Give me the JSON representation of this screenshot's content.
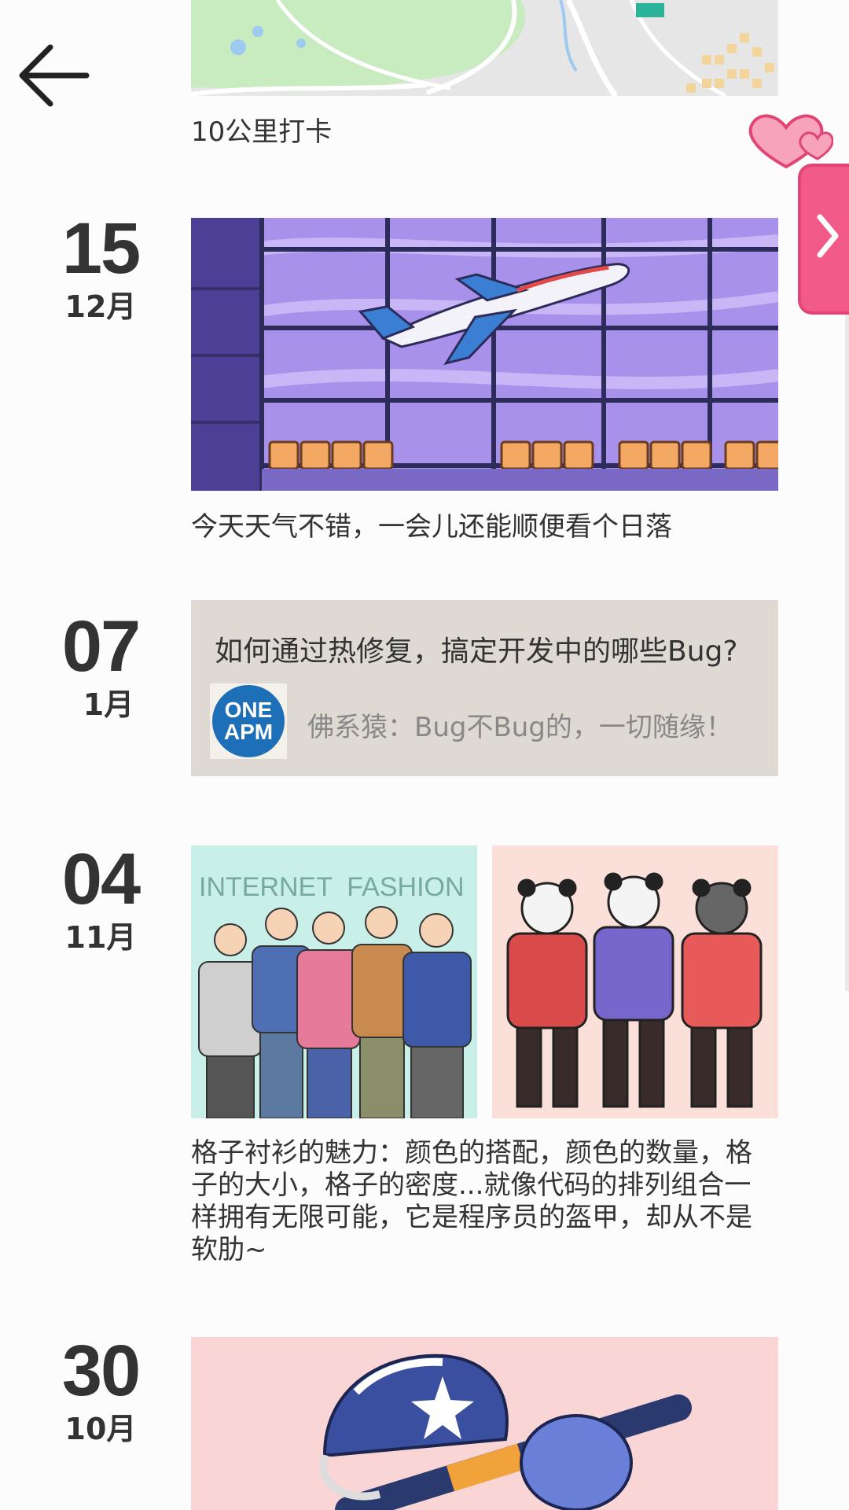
{
  "entries": [
    {
      "caption": "10公里打卡"
    },
    {
      "day": "15",
      "month": "12月",
      "caption": "今天天气不错，一会儿还能顺便看个日落"
    },
    {
      "day": "07",
      "month": "1月",
      "article_title": "如何通过热修复，搞定开发中的哪些Bug?",
      "article_subtitle": "佛系猿：Bug不Bug的，一切随缘！",
      "logo_top": "ONE",
      "logo_bottom": "APM"
    },
    {
      "day": "04",
      "month": "11月",
      "image_text": "INTERNET  FASHION",
      "caption": "格子衬衫的魅力：颜色的搭配，颜色的数量，格子的大小，格子的密度...就像代码的排列组合一样拥有无限可能，它是程序员的盔甲，却从不是软肋~"
    },
    {
      "day": "30",
      "month": "10月"
    }
  ],
  "icons": {
    "back": "arrow-left-icon",
    "side_tab": "chevron-right-icon",
    "decoration": "heart-icon"
  },
  "colors": {
    "accent": "#f25a8a",
    "text": "#333333",
    "muted": "#888888"
  }
}
